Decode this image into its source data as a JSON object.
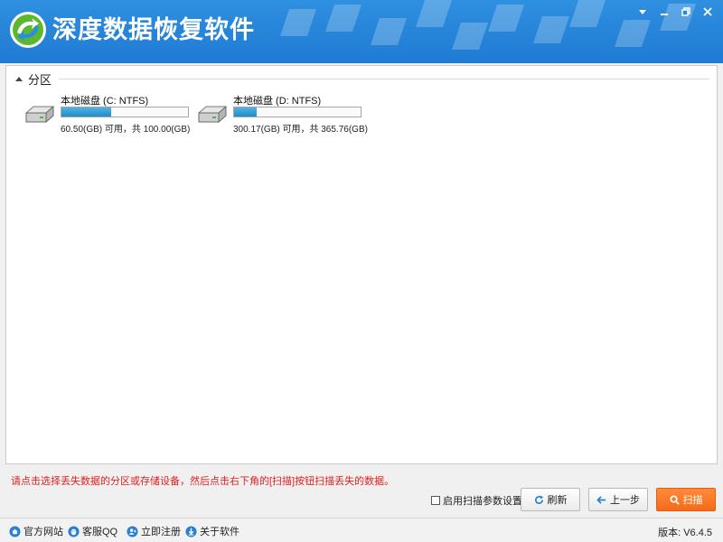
{
  "window": {
    "title": "深度数据恢复软件",
    "controls": {
      "menu": "▾",
      "minimize": "–",
      "maximize": "□",
      "close": "✕"
    }
  },
  "section": {
    "label": "分区"
  },
  "drives": [
    {
      "name": "本地磁盘 (C: NTFS)",
      "size_text": "60.50(GB) 可用，共 100.00(GB)",
      "used_fraction": 0.395
    },
    {
      "name": "本地磁盘 (D: NTFS)",
      "size_text": "300.17(GB) 可用，共 365.76(GB)",
      "used_fraction": 0.179
    }
  ],
  "hint": "请点击选择丢失数据的分区或存储设备，然后点击右下角的[扫描]按钮扫描丢失的数据。",
  "controls": {
    "scan_settings_label": "启用扫描参数设置",
    "refresh": "刷新",
    "back": "上一步",
    "scan": "扫描"
  },
  "footer": {
    "links": [
      "官方网站",
      "客服QQ",
      "立即注册",
      "关于软件"
    ],
    "version": "版本: V6.4.5"
  },
  "colors": {
    "titlebar": "#2a87dc",
    "accent_button": "#f46b1a",
    "hint_text": "#e41f1f",
    "bar_fill": "#1f8dc8"
  },
  "icons": {
    "logo": "app-logo",
    "refresh": "refresh-icon",
    "back": "arrow-left-icon",
    "scan": "search-icon",
    "footer": [
      "home-icon",
      "qq-icon",
      "user-register-icon",
      "info-download-icon"
    ]
  }
}
